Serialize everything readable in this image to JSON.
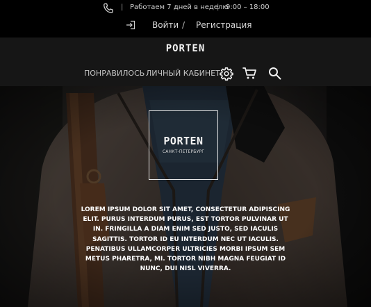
{
  "topbar": {
    "separator": "|",
    "worktime": "Работаем 7 дней в неделю",
    "hours": "9:00 – 18:00",
    "login": "Войти",
    "slash": "/",
    "register": "Регистрация"
  },
  "nav": {
    "brand": "PORTEN",
    "liked": "ПОНРАВИЛОСЬ",
    "cabinet": "ЛИЧНЫЙ КАБИНЕТ",
    "icons": [
      "gear-icon",
      "cart-icon",
      "search-icon"
    ]
  },
  "hero": {
    "logo_name": "PORTEN",
    "logo_city": "САНКТ-ПЕТЕРБУРГ",
    "text": "LOREM IPSUM DOLOR SIT AMET, CONSECTETUR ADIPISCING ELIT. PURUS INTERDUM PURUS, EST TORTOR PULVINAR UT IN. FRINGILLA A DIAM ENIM SED JUSTO, SED IACULIS SAGITTIS. TORTOR ID EU INTERDUM NEC UT IACULIS. PENATIBUS ULLAMCORPER ULTRICIES MORBI IPSUM SEM METUS PHARETRA, MI. TORTOR NIBH MAGNA FEUGIAT ID NUNC, DUI NISL VIVERRA."
  },
  "colors": {
    "topbar_bg": "#000000",
    "navbar_bg": "#161616",
    "text_light": "#d8d8d8"
  }
}
